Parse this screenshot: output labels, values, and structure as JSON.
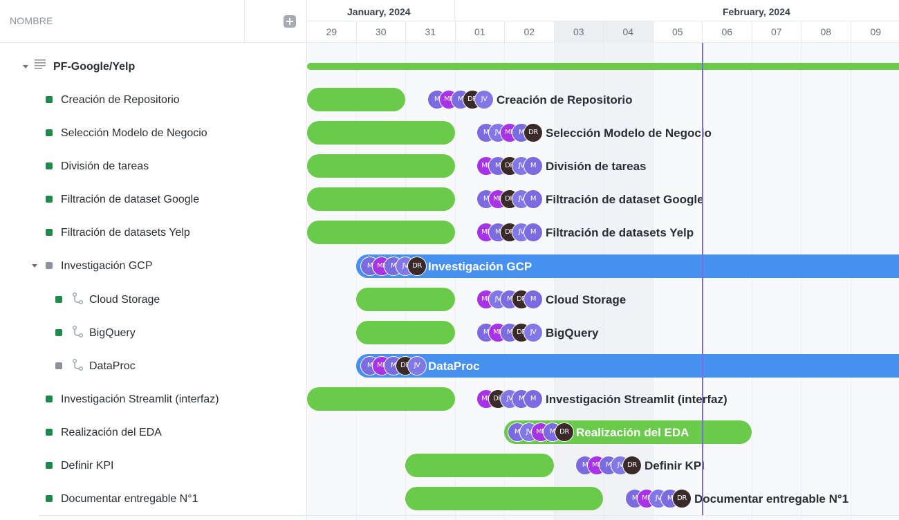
{
  "columns": {
    "name_title": "NOMBRE"
  },
  "colors": {
    "green_bar": "#6acb4b",
    "blue_bar": "#4690f0",
    "today_line": "#7b6be0",
    "status_green": "#1f8a4c",
    "status_gray": "#8c919b",
    "avatar_M": "#7b6be0",
    "avatar_MP": "#a832e8",
    "avatar_VM": "#0f6b66",
    "avatar_DR": "#3a2a2a",
    "avatar_JV": "#8277e6"
  },
  "timeline": {
    "months": [
      {
        "label": "January, 2024"
      },
      {
        "label": "February, 2024"
      }
    ],
    "days": [
      "29",
      "30",
      "31",
      "01",
      "02",
      "03",
      "04",
      "05",
      "06",
      "07",
      "08",
      "09"
    ],
    "weekend_days": [
      "03",
      "04"
    ],
    "today_between": [
      "05",
      "06"
    ]
  },
  "project": {
    "name": "PF-Google/Yelp",
    "icon": "list-icon"
  },
  "tasks": [
    {
      "name": "Creación de Repositorio",
      "status": "green",
      "avatars": [
        "M",
        "MP",
        "M",
        "DR",
        "JV"
      ]
    },
    {
      "name": "Selección Modelo de Negocio",
      "status": "green",
      "avatars": [
        "M",
        "JV",
        "MP",
        "M",
        "DR"
      ]
    },
    {
      "name": "División de tareas",
      "status": "green",
      "avatars": [
        "MP",
        "M",
        "DR",
        "JV",
        "M"
      ]
    },
    {
      "name": "Filtración de dataset Google",
      "status": "green",
      "avatars": [
        "M",
        "MP",
        "DR",
        "JV",
        "M"
      ]
    },
    {
      "name": "Filtración de datasets Yelp",
      "status": "green",
      "avatars": [
        "MP",
        "M",
        "DR",
        "JV",
        "M"
      ]
    },
    {
      "name": "Investigación GCP",
      "status": "gray",
      "avatars": [
        "M",
        "MP",
        "M",
        "JV",
        "DR"
      ]
    },
    {
      "name": "Cloud Storage",
      "status": "green",
      "avatars": [
        "MP",
        "JV",
        "M",
        "DR",
        "M"
      ]
    },
    {
      "name": "BigQuery",
      "status": "green",
      "avatars": [
        "M",
        "MP",
        "M",
        "DR",
        "JV"
      ]
    },
    {
      "name": "DataProc",
      "status": "gray",
      "avatars": [
        "M",
        "MP",
        "M",
        "DR",
        "JV"
      ]
    },
    {
      "name": "Investigación Streamlit (interfaz)",
      "status": "green",
      "avatars": [
        "MP",
        "DR",
        "JV",
        "M",
        "M"
      ]
    },
    {
      "name": "Realización del EDA",
      "status": "green",
      "avatars": [
        "M",
        "JV",
        "MP",
        "M",
        "DR"
      ]
    },
    {
      "name": "Definir KPI",
      "status": "green",
      "avatars": [
        "M",
        "MP",
        "M",
        "JV",
        "DR"
      ]
    },
    {
      "name": "Documentar entregable N°1",
      "status": "green",
      "avatars": [
        "M",
        "MP",
        "JV",
        "M",
        "DR"
      ]
    }
  ]
}
